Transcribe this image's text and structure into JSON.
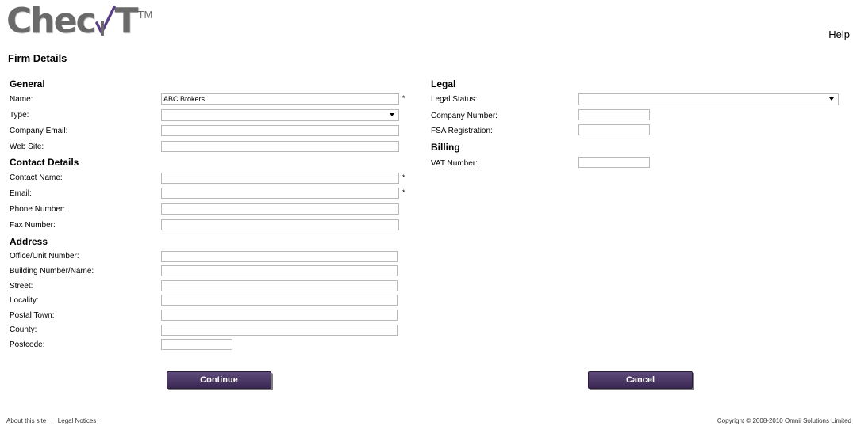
{
  "header": {
    "logo_text": "CheckIT",
    "logo_tm": "TM",
    "help_label": "Help",
    "page_title": "Firm Details"
  },
  "general": {
    "heading": "General",
    "name_label": "Name:",
    "name_value": "ABC Brokers",
    "type_label": "Type:",
    "company_email_label": "Company Email:",
    "web_site_label": "Web Site:"
  },
  "contact": {
    "heading": "Contact Details",
    "contact_name_label": "Contact Name:",
    "email_label": "Email:",
    "phone_label": "Phone Number:",
    "fax_label": "Fax Number:"
  },
  "address": {
    "heading": "Address",
    "office_label": "Office/Unit Number:",
    "building_label": "Building Number/Name:",
    "street_label": "Street:",
    "locality_label": "Locality:",
    "postal_town_label": "Postal Town:",
    "county_label": "County:",
    "postcode_label": "Postcode:"
  },
  "legal": {
    "heading": "Legal",
    "legal_status_label": "Legal Status:",
    "company_number_label": "Company Number:",
    "fsa_label": "FSA Registration:"
  },
  "billing": {
    "heading": "Billing",
    "vat_label": "VAT Number:"
  },
  "required_marker": "*",
  "buttons": {
    "continue_label": "Continue",
    "cancel_label": "Cancel"
  },
  "footer": {
    "about_label": "About this site",
    "separator": "|",
    "legal_notices_label": "Legal Notices",
    "copyright": "Copyright © 2008-2010 Omnii Solutions Limited"
  },
  "colors": {
    "button": "#4a3764",
    "logo_grey": "#6a6a6a",
    "logo_purple": "#5b3f86"
  }
}
